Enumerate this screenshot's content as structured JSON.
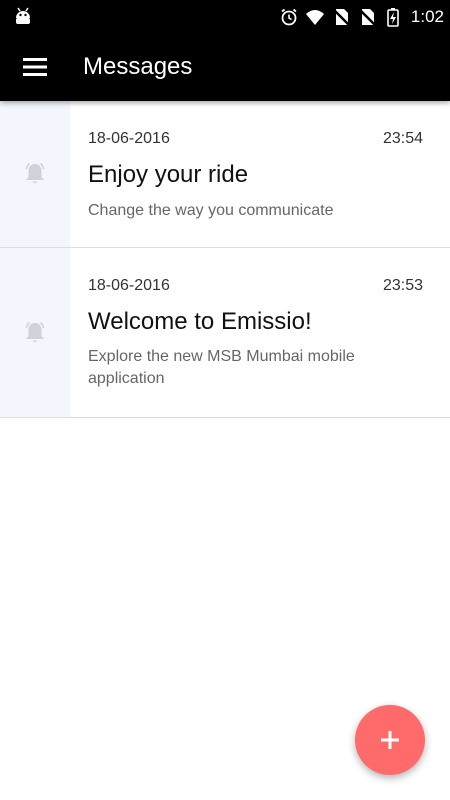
{
  "status_bar": {
    "time": "1:02",
    "icons": [
      "android-debug-icon",
      "alarm-icon",
      "wifi-icon",
      "no-sim-icon",
      "no-sim-icon",
      "battery-charging-icon"
    ]
  },
  "app_bar": {
    "title": "Messages",
    "menu_icon": "hamburger-menu-icon",
    "background": "#000000"
  },
  "messages": [
    {
      "date": "18-06-2016",
      "time": "23:54",
      "title": "Enjoy your ride",
      "body": "Change the way you communicate",
      "icon": "bell-icon"
    },
    {
      "date": "18-06-2016",
      "time": "23:53",
      "title": "Welcome to Emissio!",
      "body": "Explore the new MSB Mumbai mobile application",
      "icon": "bell-icon"
    }
  ],
  "fab": {
    "icon": "plus-icon",
    "color": "#ff6b6b"
  },
  "colors": {
    "icon_column_bg": "#f3f7fd",
    "bell_icon": "#cfd3d8",
    "divider": "#dddddd"
  }
}
